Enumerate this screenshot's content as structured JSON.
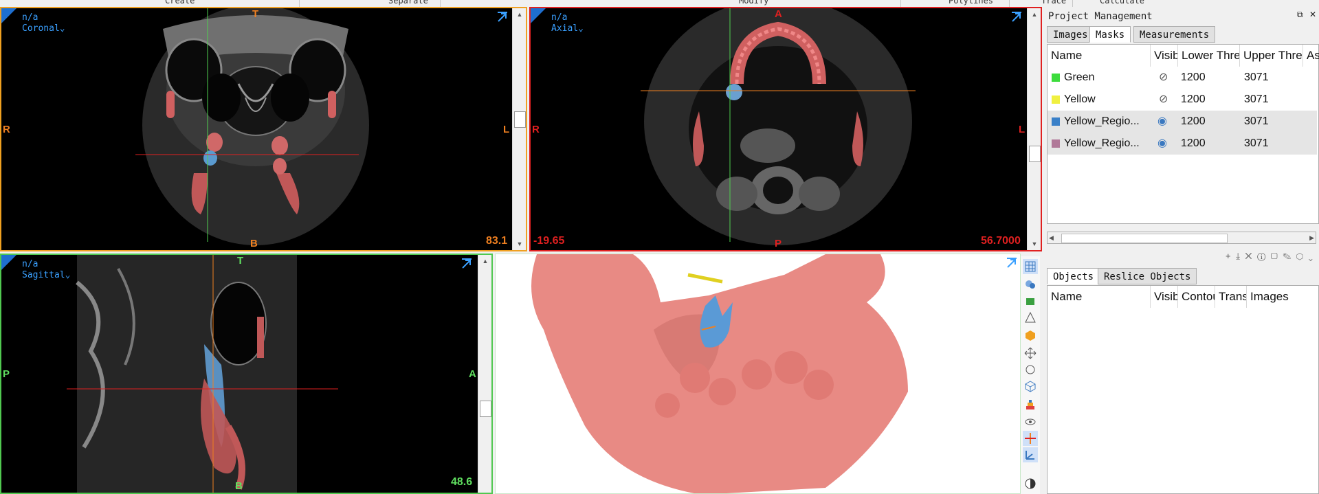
{
  "toolbar_strip": {
    "items": [
      "Create",
      "Separate",
      "Modify",
      "Polylines",
      "Trace",
      "Calculate"
    ]
  },
  "viewports": {
    "coronal": {
      "na": "n/a",
      "view": "Coronal",
      "top": "T",
      "bottom": "B",
      "left_side": "R",
      "right_side": "L",
      "value": "83.1",
      "border_color": "#f0a020",
      "label_color": "#f08020"
    },
    "axial": {
      "na": "n/a",
      "view": "Axial",
      "top": "A",
      "bottom": "P",
      "left_side": "R",
      "right_side": "L",
      "value_left": "-19.65",
      "value": "56.7000",
      "border_color": "#e02020",
      "label_color": "#e02020"
    },
    "sagittal": {
      "na": "n/a",
      "view": "Sagittal",
      "top": "T",
      "bottom": "B",
      "left_side": "P",
      "right_side": "A",
      "value": "48.6",
      "border_color": "#50c850",
      "label_color": "#60e060"
    },
    "threed": {
      "name": "3D view"
    }
  },
  "tools_3d": [
    "grid-icon",
    "spheres-icon",
    "box-icon",
    "cone-icon",
    "cube-orange-icon",
    "move-icon",
    "rotate-icon",
    "cube-icon",
    "layers-icon",
    "eye-icon",
    "crosshair-icon",
    "axes-icon",
    "contrast-icon"
  ],
  "project": {
    "title": "Project Management",
    "tabs": [
      "Images",
      "Masks",
      "Measurements"
    ],
    "active_tab": "Masks",
    "mask_columns": [
      "Name",
      "Visible",
      "Lower Threshold",
      "Upper Threshold",
      "As"
    ],
    "masks": [
      {
        "name": "Green",
        "color": "#3cdc3c",
        "visible": false,
        "lower": "1200",
        "upper": "3071"
      },
      {
        "name": "Yellow",
        "color": "#f0f040",
        "visible": false,
        "lower": "1200",
        "upper": "3071"
      },
      {
        "name": "Yellow_Regio...",
        "color": "#3a80c8",
        "visible": true,
        "lower": "1200",
        "upper": "3071"
      },
      {
        "name": "Yellow_Regio...",
        "color": "#b07898",
        "visible": true,
        "lower": "1200",
        "upper": "3071"
      }
    ],
    "mask_tools": "+ ⤓ ✕ ⓘ ▢ ✎ ⬡ ⌄",
    "object_tabs": [
      "Objects",
      "Reslice Objects"
    ],
    "active_object_tab": "Objects",
    "object_columns": [
      "Name",
      "Visible",
      "Contour",
      "Transparency",
      "Images"
    ]
  }
}
